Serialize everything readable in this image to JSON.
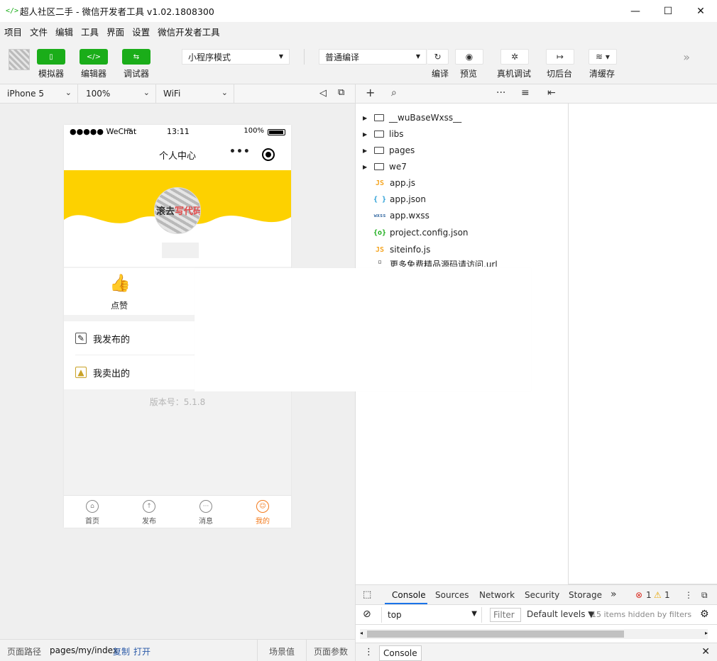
{
  "window": {
    "title": "超人社区二手 - 微信开发者工具 v1.02.1808300",
    "minimize": "—",
    "maximize": "☐",
    "close": "✕"
  },
  "menu": [
    "项目",
    "文件",
    "编辑",
    "工具",
    "界面",
    "设置",
    "微信开发者工具"
  ],
  "toolbar": {
    "simulator_label": "模拟器",
    "editor_label": "编辑器",
    "debugger_label": "调试器",
    "mode_select": "小程序模式",
    "compile_select": "普通编译",
    "compile_label": "编译",
    "preview_label": "预览",
    "remote_debug_label": "真机调试",
    "background_label": "切后台",
    "clear_cache_label": "清缓存"
  },
  "sim_options": {
    "device": "iPhone 5",
    "zoom": "100%",
    "network": "WiFi"
  },
  "phone": {
    "carrier": "●●●●● WeChat",
    "time": "13:11",
    "battery": "100%",
    "nav_title": "个人中心",
    "capsule_dots": "•••",
    "profile_text_a": "滚去",
    "profile_text_b": "写代码",
    "like_label": "点赞",
    "list": [
      {
        "label": "我发布的"
      },
      {
        "label": "我卖出的"
      }
    ],
    "version": "版本号：5.1.8",
    "tabs": [
      {
        "label": "首页",
        "active": false
      },
      {
        "label": "发布",
        "active": false
      },
      {
        "label": "消息",
        "active": false
      },
      {
        "label": "我的",
        "active": true
      }
    ],
    "banner_color": "#fdd100",
    "accent_color": "#f37b1d"
  },
  "file_tree": {
    "folders": [
      "__wuBaseWxss__",
      "libs",
      "pages",
      "we7"
    ],
    "files": [
      {
        "icon": "JS",
        "name": "app.js",
        "color": "#f5a623"
      },
      {
        "icon": "{ }",
        "name": "app.json",
        "color": "#2a9fd6"
      },
      {
        "icon": "wxss",
        "name": "app.wxss",
        "color": "#3b6ea5"
      },
      {
        "icon": "{o}",
        "name": "project.config.json",
        "color": "#1aad19"
      },
      {
        "icon": "JS",
        "name": "siteinfo.js",
        "color": "#f5a623"
      },
      {
        "icon": "▫",
        "name": "更多免费精品源码请访问.url",
        "color": "#444"
      }
    ]
  },
  "devtools": {
    "tabs": [
      "Console",
      "Sources",
      "Network",
      "Security",
      "Storage"
    ],
    "more": "»",
    "errors": "1",
    "warnings": "1",
    "context": "top",
    "filter_placeholder": "Filter",
    "levels": "Default levels ▼",
    "hidden_info": "15 items hidden by filters",
    "drawer_tab": "Console"
  },
  "footer": {
    "path_label": "页面路径",
    "path_value": "pages/my/index",
    "copy": "复制",
    "open": "打开",
    "scene": "场景值",
    "params": "页面参数"
  }
}
